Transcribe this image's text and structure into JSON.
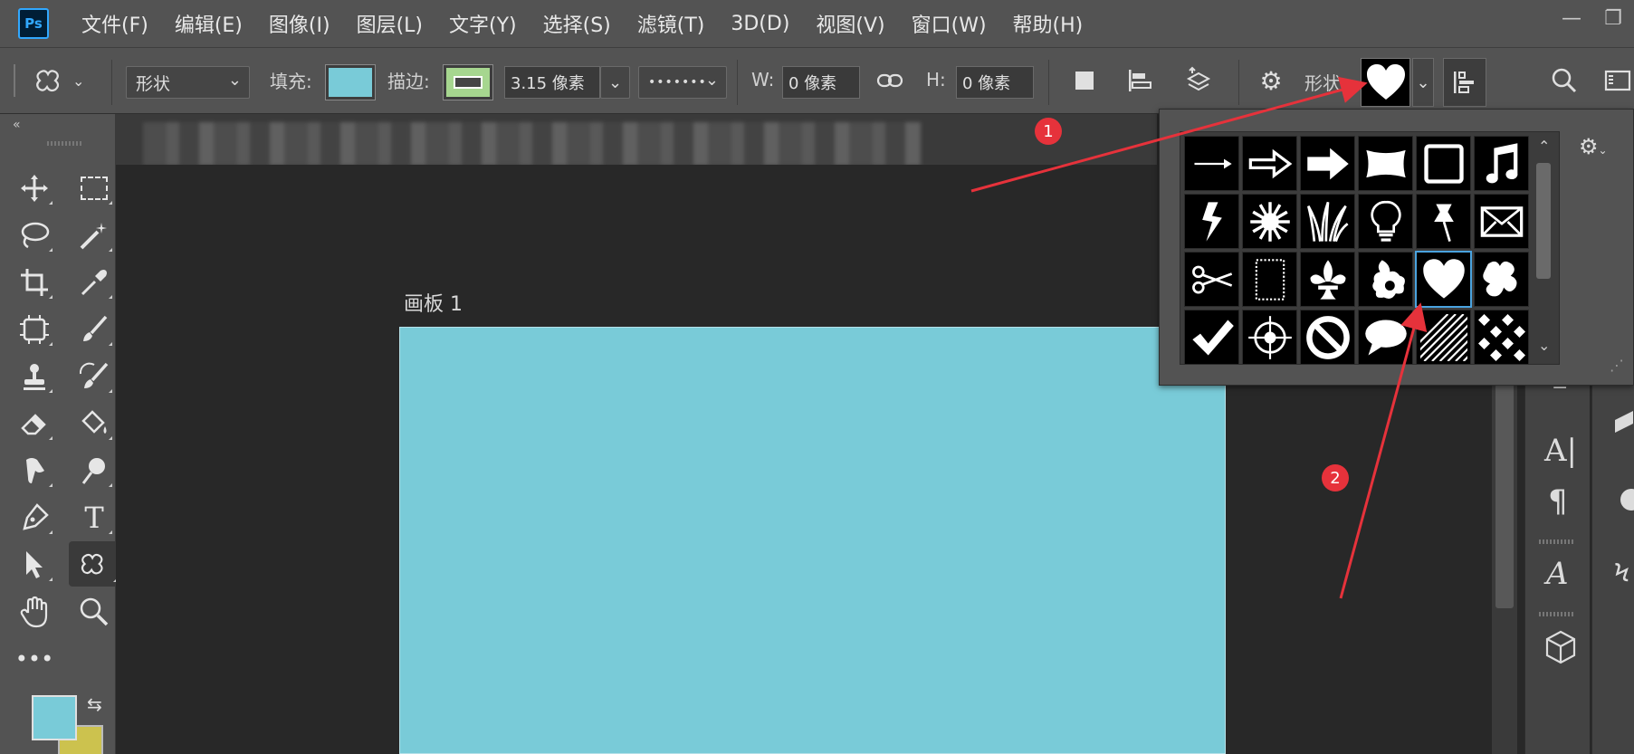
{
  "app": {
    "logo": "Ps",
    "brand_color": "#31a8ff",
    "menu": [
      "文件(F)",
      "编辑(E)",
      "图像(I)",
      "图层(L)",
      "文字(Y)",
      "选择(S)",
      "滤镜(T)",
      "3D(D)",
      "视图(V)",
      "窗口(W)",
      "帮助(H)"
    ],
    "window_buttons": [
      "minimize-icon",
      "restore-icon"
    ]
  },
  "options_bar": {
    "tool_preset_icon": "custom-shape-tool-icon",
    "mode_value": "形状",
    "fill_label": "填充:",
    "fill_color": "#79cbd8",
    "stroke_label": "描边:",
    "stroke_color": "#a6d68f",
    "stroke_width": "3.15 像素",
    "stroke_style": "•••••••",
    "w_label": "W:",
    "w_value": "0 像素",
    "h_label": "H:",
    "h_value": "0 像素",
    "shape_label": "形状:",
    "selected_shape": "heart",
    "icons": [
      "link-icon",
      "path-operations-icon",
      "path-alignment-icon",
      "path-arrangement-icon",
      "gear-icon",
      "align-edges-icon",
      "search-icon",
      "workspace-icon"
    ]
  },
  "document": {
    "artboard_title": "画板 1",
    "artboard_color": "#79cbd8"
  },
  "color_swatches": {
    "foreground": "#79cbd8",
    "background": "#ccc24e"
  },
  "shape_picker": {
    "shapes": [
      "arrow-thin",
      "arrow-medium",
      "arrow-bold",
      "banner",
      "frame",
      "music-note",
      "lightning",
      "starburst",
      "grass",
      "light-bulb",
      "pushpin",
      "envelope",
      "scissors",
      "postage-stamp",
      "fleur-de-lis",
      "ornament",
      "heart",
      "puzzle-blob",
      "checkmark",
      "target-crosshair",
      "no-symbol",
      "speech-bubble",
      "diagonal-stripes",
      "checkerboard"
    ],
    "selected_index": 16
  },
  "annotations": {
    "badge_1": "1",
    "badge_2": "2",
    "arrow_color": "#e6323b"
  },
  "right_panel_icons": [
    "character-icon",
    "paragraph-icon",
    "glyphs-icon",
    "3d-icon",
    "layers-icon",
    "channels-icon",
    "paths-icon"
  ]
}
